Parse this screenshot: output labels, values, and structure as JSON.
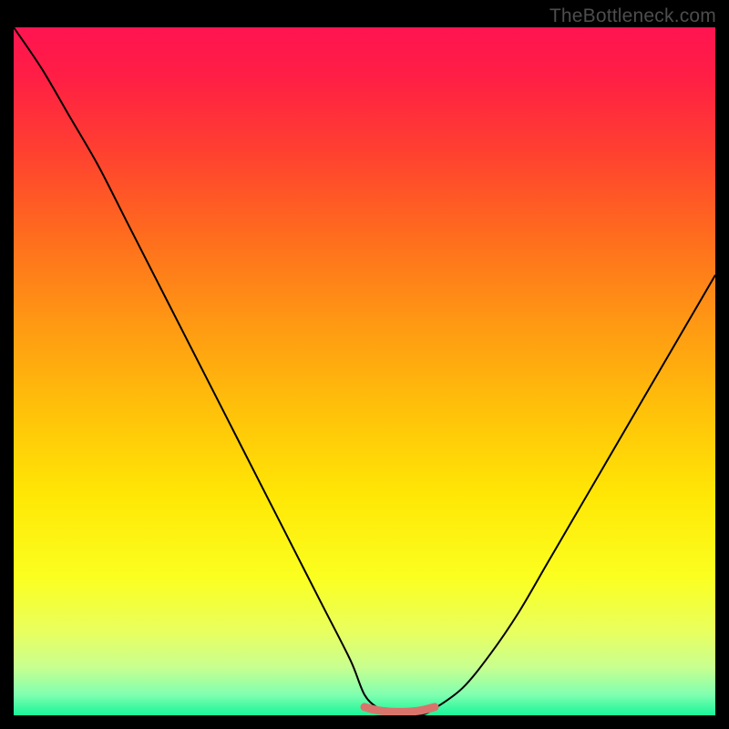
{
  "watermark": "TheBottleneck.com",
  "chart_data": {
    "type": "line",
    "title": "",
    "xlabel": "",
    "ylabel": "",
    "xlim": [
      0,
      100
    ],
    "ylim": [
      0,
      100
    ],
    "series": [
      {
        "name": "bottleneck-curve",
        "x": [
          0,
          4,
          8,
          12,
          16,
          20,
          24,
          28,
          32,
          36,
          40,
          44,
          48,
          50,
          52,
          54,
          56,
          58,
          60,
          64,
          68,
          72,
          76,
          80,
          84,
          88,
          92,
          96,
          100
        ],
        "y": [
          100,
          94,
          87,
          80,
          72,
          64,
          56,
          48,
          40,
          32,
          24,
          16,
          8,
          3,
          1,
          0,
          0,
          0,
          1,
          4,
          9,
          15,
          22,
          29,
          36,
          43,
          50,
          57,
          64
        ]
      },
      {
        "name": "optimal-band",
        "x": [
          50,
          52,
          54,
          56,
          58,
          60
        ],
        "y": [
          1.2,
          0.7,
          0.5,
          0.5,
          0.7,
          1.2
        ]
      }
    ],
    "gradient_stops": [
      {
        "offset": 0.0,
        "color": "#ff1450"
      },
      {
        "offset": 0.07,
        "color": "#ff1e45"
      },
      {
        "offset": 0.18,
        "color": "#ff4030"
      },
      {
        "offset": 0.3,
        "color": "#ff6b1e"
      },
      {
        "offset": 0.42,
        "color": "#ff9514"
      },
      {
        "offset": 0.55,
        "color": "#ffbf0a"
      },
      {
        "offset": 0.68,
        "color": "#ffe705"
      },
      {
        "offset": 0.8,
        "color": "#fbff20"
      },
      {
        "offset": 0.88,
        "color": "#e8ff60"
      },
      {
        "offset": 0.93,
        "color": "#c8ff90"
      },
      {
        "offset": 0.97,
        "color": "#80ffb0"
      },
      {
        "offset": 1.0,
        "color": "#18f598"
      }
    ],
    "curve_color": "#000000",
    "optimal_band_color": "#d9746c"
  }
}
